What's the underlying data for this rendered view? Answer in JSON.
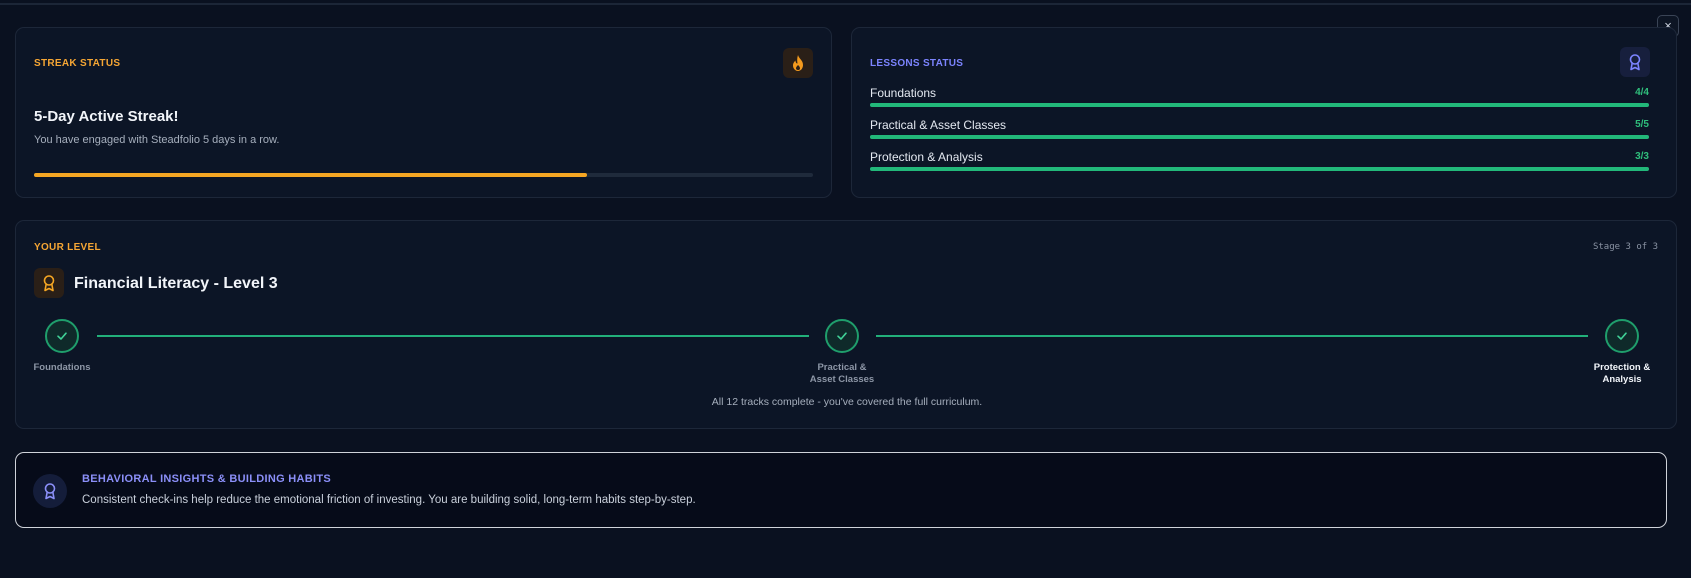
{
  "window": {
    "close_label": "×"
  },
  "streak": {
    "label": "STREAK STATUS",
    "icon": "flame-icon",
    "title": "5-Day Active Streak!",
    "subtitle": "You have engaged with Steadfolio 5 days in a row.",
    "progress": 0.71,
    "color": "#f5a623"
  },
  "lessons": {
    "label": "LESSONS STATUS",
    "icon": "award-ribbon-icon",
    "items": [
      {
        "name": "Foundations",
        "count": "4/4",
        "progress": 1.0
      },
      {
        "name": "Practical & Asset Classes",
        "count": "5/5",
        "progress": 1.0
      },
      {
        "name": "Protection & Analysis",
        "count": "3/3",
        "progress": 1.0
      }
    ],
    "color": "#22b87a"
  },
  "level": {
    "label": "YOUR LEVEL",
    "stage": "Stage 3 of 3",
    "icon": "award-ribbon-icon",
    "title": "Financial Literacy - Level 3",
    "steps": [
      {
        "label_line1": "Foundations",
        "label_line2": "",
        "state": "complete"
      },
      {
        "label_line1": "Practical &",
        "label_line2": "Asset Classes",
        "state": "complete"
      },
      {
        "label_line1": "Protection &",
        "label_line2": "Analysis",
        "state": "current"
      }
    ],
    "note": "All 12 tracks complete - you've covered the full curriculum."
  },
  "insights": {
    "icon": "award-ribbon-icon",
    "title": "BEHAVIORAL INSIGHTS & BUILDING HABITS",
    "text": "Consistent check-ins help reduce the emotional friction of investing. You are building solid, long-term habits step-by-step."
  }
}
